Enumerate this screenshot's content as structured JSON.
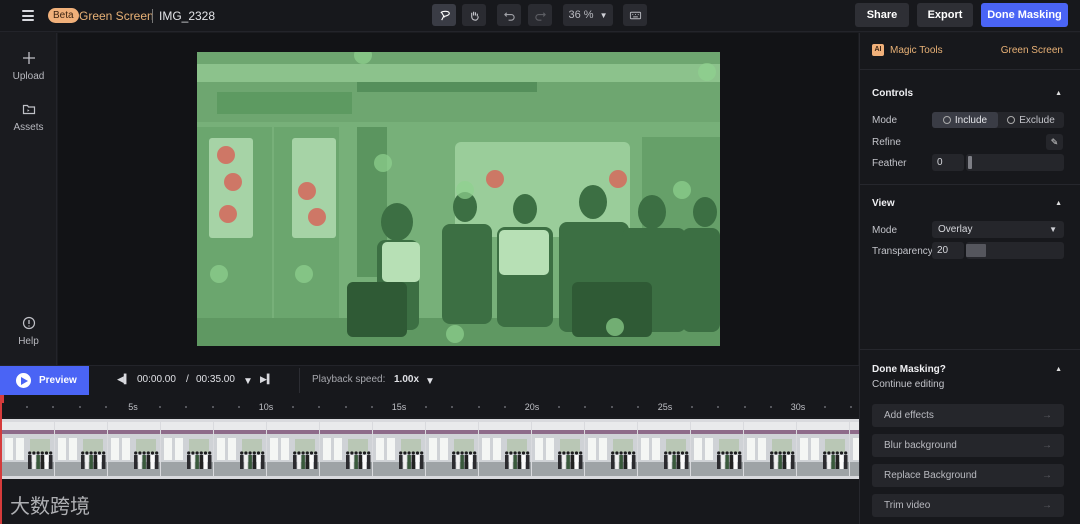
{
  "header": {
    "badge": "Beta",
    "project": "Green Screen",
    "filename": "IMG_2328",
    "zoom": "36 %",
    "share_label": "Share",
    "export_label": "Export",
    "done_label": "Done Masking"
  },
  "sidebar": {
    "items": [
      {
        "label": "Upload",
        "icon": "plus-icon"
      },
      {
        "label": "Assets",
        "icon": "folder-icon"
      },
      {
        "label": "Help",
        "icon": "info-icon"
      }
    ]
  },
  "panel": {
    "magic_tools": "Magic Tools",
    "green_screen": "Green Screen",
    "controls": {
      "title": "Controls",
      "mode_label": "Mode",
      "include": "Include",
      "exclude": "Exclude",
      "selected_mode": "Include",
      "refine_label": "Refine",
      "feather_label": "Feather",
      "feather_value": "0",
      "feather_level": 0
    },
    "view": {
      "title": "View",
      "mode_label": "Mode",
      "mode_value": "Overlay",
      "transparency_label": "Transparency",
      "transparency_value": "20",
      "transparency_level": 0.2
    },
    "done": {
      "title": "Done Masking?",
      "continue": "Continue editing",
      "actions": [
        "Add effects",
        "Blur background",
        "Replace Background",
        "Trim video"
      ]
    }
  },
  "playback": {
    "preview_label": "Preview",
    "current_time": "00:00.00",
    "separator": "/",
    "total_time": "00:35.00",
    "speed_label": "Playback speed:",
    "speed_value": "1.00x"
  },
  "timeline": {
    "labels": [
      "5s",
      "10s",
      "15s",
      "20s",
      "25s",
      "30s"
    ]
  },
  "watermark": "大数跨境",
  "colors": {
    "accent": "#4a64f5",
    "brand_orange": "#e8b176",
    "mask_green": "#6fae73",
    "mask_red": "#d56a5c"
  }
}
